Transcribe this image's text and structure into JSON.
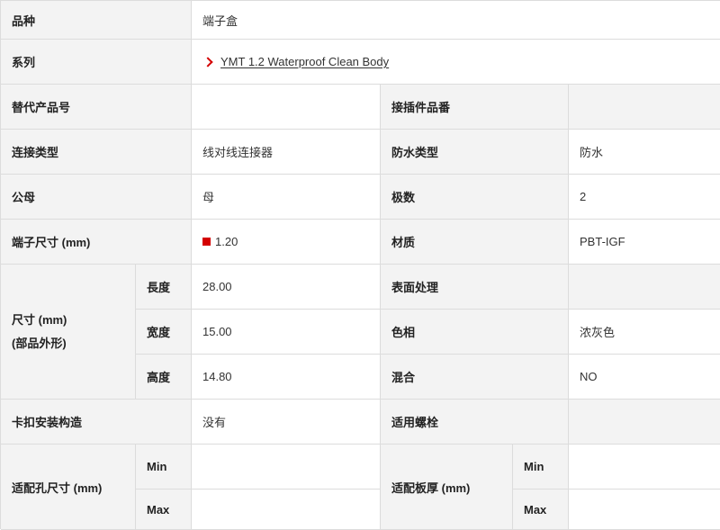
{
  "rows": {
    "variety": {
      "label": "品种",
      "value": "端子盒"
    },
    "series": {
      "label": "系列",
      "link": "YMT 1.2 Waterproof Clean Body"
    },
    "alt_part_no": {
      "label": "替代产品号",
      "value": ""
    },
    "connector_part_no": {
      "label": "接插件品番",
      "value": ""
    },
    "connection_type": {
      "label": "连接类型",
      "value": "线对线连接器"
    },
    "waterproof_type": {
      "label": "防水类型",
      "value": "防水"
    },
    "gender": {
      "label": "公母",
      "value": "母"
    },
    "poles": {
      "label": "极数",
      "value": "2"
    },
    "terminal_size": {
      "label": "端子尺寸 (mm)",
      "value": "1.20",
      "marker_color": "#d40000"
    },
    "material": {
      "label": "材质",
      "value": "PBT-IGF"
    },
    "dimensions": {
      "label_line1": "尺寸 (mm)",
      "label_line2": "(部品外形)",
      "length": {
        "label": "長度",
        "value": "28.00"
      },
      "width": {
        "label": "宽度",
        "value": "15.00"
      },
      "height": {
        "label": "高度",
        "value": "14.80"
      }
    },
    "surface": {
      "label": "表面处理",
      "value": ""
    },
    "color": {
      "label": "色相",
      "value": "浓灰色"
    },
    "mixed": {
      "label": "混合",
      "value": "NO"
    },
    "clip_structure": {
      "label": "卡扣安装构造",
      "value": "没有"
    },
    "bolt": {
      "label": "适用螺栓",
      "value": ""
    },
    "hole_size": {
      "label": "适配孔尺寸 (mm)",
      "min_label": "Min",
      "max_label": "Max",
      "min": "",
      "max": ""
    },
    "panel_thickness": {
      "label": "适配板厚 (mm)",
      "min_label": "Min",
      "max_label": "Max",
      "min": "",
      "max": ""
    }
  },
  "colors": {
    "accent": "#d40000",
    "header_bg": "#f3f3f3",
    "border": "#dcdcdc"
  }
}
